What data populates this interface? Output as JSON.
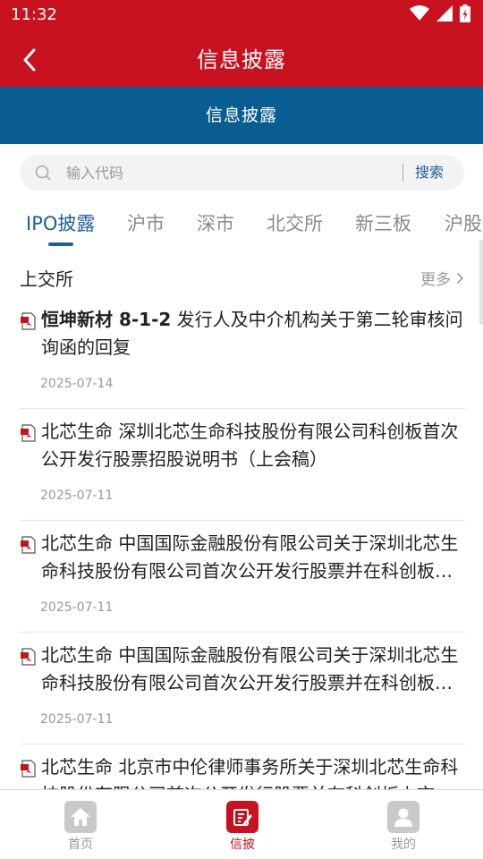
{
  "status_bar": {
    "time": "11:32"
  },
  "header": {
    "title": "信息披露",
    "back_icon": "chevron-left-icon"
  },
  "banner": {
    "text": "信息披露"
  },
  "search": {
    "placeholder": "输入代码",
    "button_label": "搜索"
  },
  "tabs": [
    {
      "label": "IPO披露",
      "active": true
    },
    {
      "label": "沪市",
      "active": false
    },
    {
      "label": "深市",
      "active": false
    },
    {
      "label": "北交所",
      "active": false
    },
    {
      "label": "新三板",
      "active": false
    },
    {
      "label": "沪股",
      "active": false
    }
  ],
  "section": {
    "title": "上交所",
    "more_label": "更多"
  },
  "items": [
    {
      "title_bold": "恒坤新材 8-1-2",
      "title_rest": " 发行人及中介机构关于第二轮审核问询函的回复",
      "date": "2025-07-14"
    },
    {
      "title_bold": "",
      "title_rest": "北芯生命 深圳北芯生命科技股份有限公司科创板首次公开发行股票招股说明书（上会稿）",
      "date": "2025-07-11"
    },
    {
      "title_bold": "",
      "title_rest": "北芯生命 中国国际金融股份有限公司关于深圳北芯生命科技股份有限公司首次公开发行股票并在科创板上市的发行保荐书",
      "date": "2025-07-11"
    },
    {
      "title_bold": "",
      "title_rest": "北芯生命 中国国际金融股份有限公司关于深圳北芯生命科技股份有限公司首次公开发行股票并在科创板上市的上市保荐书",
      "date": "2025-07-11"
    },
    {
      "title_bold": "",
      "title_rest": "北芯生命 北京市中伦律师事务所关于深圳北芯生命科技股份有限公司首次公开发行股票并在科创板上市的法律意见书",
      "date": "2025-07-11"
    }
  ],
  "bottom_nav": [
    {
      "label": "首页",
      "icon": "home-icon",
      "active": false
    },
    {
      "label": "信披",
      "icon": "disclosure-icon",
      "active": true
    },
    {
      "label": "我的",
      "icon": "profile-icon",
      "active": false
    }
  ],
  "colors": {
    "header_red": "#c8121f",
    "banner_blue": "#0a5d92",
    "accent_blue": "#1b5e9a"
  }
}
